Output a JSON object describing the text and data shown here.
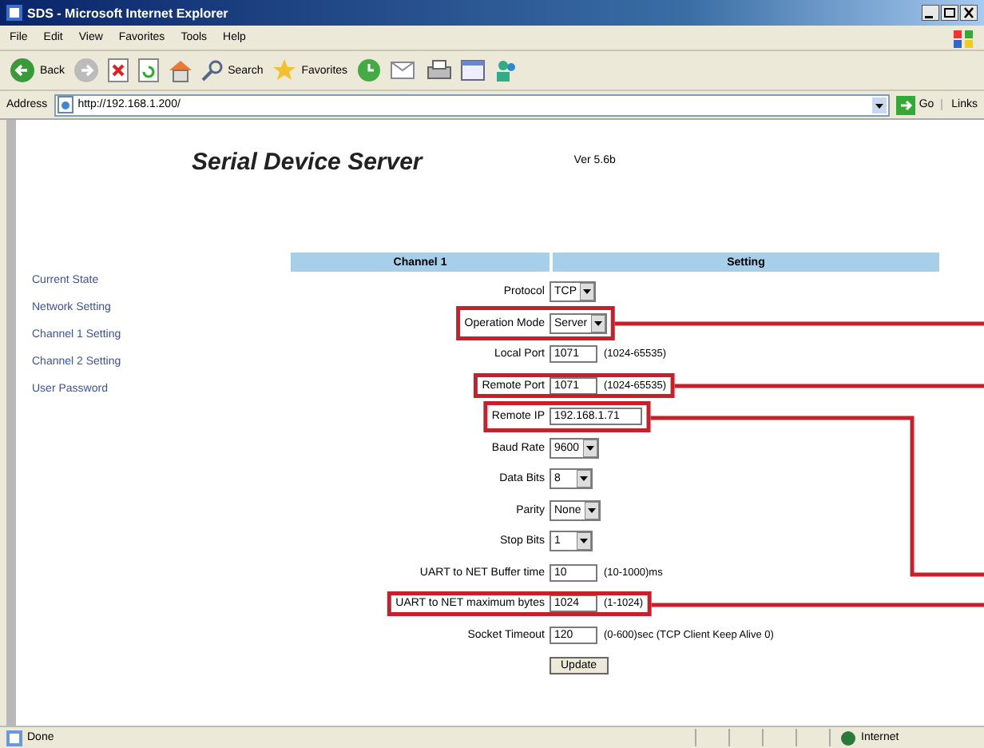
{
  "window": {
    "title": "SDS - Microsoft Internet Explorer"
  },
  "menu": [
    "File",
    "Edit",
    "View",
    "Favorites",
    "Tools",
    "Help"
  ],
  "toolbar": {
    "back": "Back",
    "search": "Search",
    "favorites": "Favorites"
  },
  "address_bar": {
    "label": "Address",
    "value": "http://192.168.1.200/",
    "go": "Go",
    "links": "Links"
  },
  "page": {
    "heading": "Serial Device Server",
    "version": "Ver 5.6b",
    "sidebar": {
      "items": [
        {
          "label": "Current State"
        },
        {
          "label": "Network Setting"
        },
        {
          "label": "Channel 1 Setting"
        },
        {
          "label": "Channel 2 Setting"
        },
        {
          "label": "User Password"
        }
      ]
    },
    "table": {
      "columns": [
        "Channel 1",
        "Setting"
      ],
      "rows": [
        {
          "label": "Protocol",
          "kind": "select",
          "value": "TCP",
          "highlighted": false
        },
        {
          "label": "Operation Mode",
          "kind": "select",
          "value": "Server",
          "highlighted": true,
          "callout_elbow": false
        },
        {
          "label": "Local Port",
          "kind": "input",
          "value": "1071",
          "hint": "(1024-65535)",
          "highlighted": false
        },
        {
          "label": "Remote Port",
          "kind": "input",
          "value": "1071",
          "hint": "(1024-65535)",
          "highlighted": true,
          "callout_elbow": false
        },
        {
          "label": "Remote IP",
          "kind": "input",
          "value": "192.168.1.71",
          "highlighted": true,
          "callout_elbow": true
        },
        {
          "label": "Baud Rate",
          "kind": "select",
          "value": "9600",
          "highlighted": false
        },
        {
          "label": "Data Bits",
          "kind": "select",
          "value": "8",
          "highlighted": false
        },
        {
          "label": "Parity",
          "kind": "select",
          "value": "None",
          "highlighted": false
        },
        {
          "label": "Stop Bits",
          "kind": "select",
          "value": "1",
          "highlighted": false
        },
        {
          "label": "UART to NET Buffer time",
          "kind": "input",
          "value": "10",
          "hint": "(10-1000)ms",
          "highlighted": false
        },
        {
          "label": "UART to NET maximum bytes",
          "kind": "input",
          "value": "1024",
          "hint": "(1-1024)",
          "highlighted": true,
          "callout_elbow": false
        },
        {
          "label": "Socket Timeout",
          "kind": "input",
          "value": "120",
          "hint": "(0-600)sec (TCP Client Keep Alive 0)",
          "highlighted": false
        }
      ]
    },
    "submit": "Update"
  },
  "status_bar": {
    "text": "Done",
    "zone": "Internet"
  }
}
